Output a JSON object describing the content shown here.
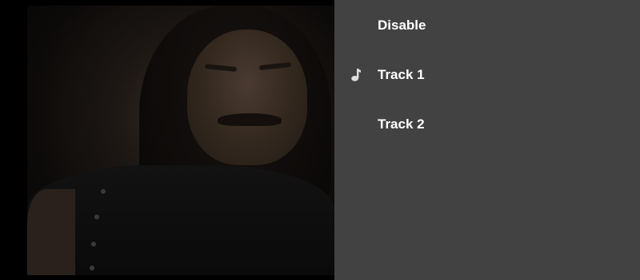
{
  "video": {
    "description_icon": "video-frame"
  },
  "track_menu": {
    "items": [
      {
        "label": "Disable",
        "selected": false,
        "icon": ""
      },
      {
        "label": "Track 1",
        "selected": true,
        "icon": "music-note-icon"
      },
      {
        "label": "Track 2",
        "selected": false,
        "icon": ""
      }
    ]
  },
  "colors": {
    "panel_background": "#424242",
    "text": "#ffffff",
    "icon": "#dddddd"
  }
}
